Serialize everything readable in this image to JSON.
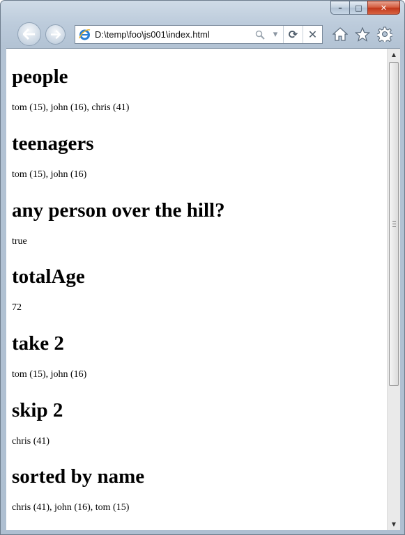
{
  "window": {
    "caption": {
      "minimize": "–",
      "maximize": "□",
      "close": "✕"
    }
  },
  "toolbar": {
    "back_icon": "back-arrow",
    "forward_icon": "forward-arrow",
    "address": "D:\\temp\\foo\\js001\\index.html",
    "icons": [
      "ie-icon",
      "search-icon",
      "dropdown-arrow-icon",
      "refresh-icon",
      "stop-icon",
      "home-icon",
      "favorites-star-icon",
      "tools-gear-icon"
    ]
  },
  "page": {
    "sections": [
      {
        "heading": "people",
        "text": "tom (15), john (16), chris (41)"
      },
      {
        "heading": "teenagers",
        "text": "tom (15), john (16)"
      },
      {
        "heading": "any person over the hill?",
        "text": "true"
      },
      {
        "heading": "totalAge",
        "text": "72"
      },
      {
        "heading": "take 2",
        "text": "tom (15), john (16)"
      },
      {
        "heading": "skip 2",
        "text": "chris (41)"
      },
      {
        "heading": "sorted by name",
        "text": "chris (41), john (16), tom (15)"
      }
    ]
  },
  "colors": {
    "frame": "#b3c3d4",
    "close_button": "#c1361b",
    "page_bg": "#ffffff"
  }
}
